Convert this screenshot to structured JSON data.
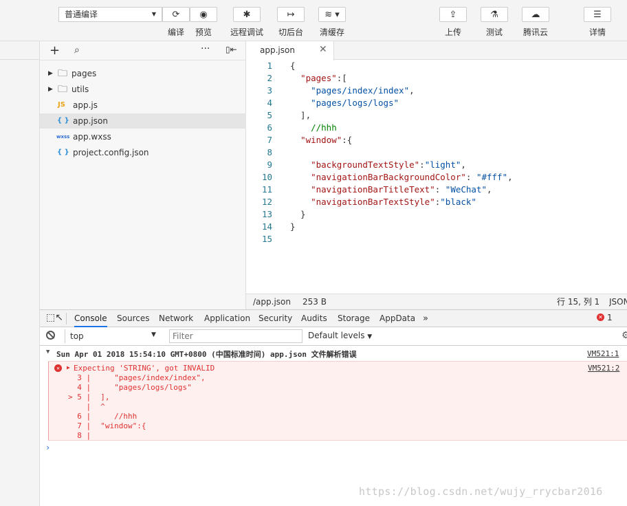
{
  "toolbar": {
    "mode_select": "普通编译",
    "compile": "编译",
    "preview": "预览",
    "remote_debug": "远程调试",
    "background": "切后台",
    "clear_cache": "清缓存",
    "upload": "上传",
    "test": "测试",
    "tencent_cloud": "腾讯云",
    "details": "详情"
  },
  "tree": {
    "items": [
      {
        "name": "pages",
        "type": "folder"
      },
      {
        "name": "utils",
        "type": "folder"
      },
      {
        "name": "app.js",
        "type": "js",
        "icon": "JS"
      },
      {
        "name": "app.json",
        "type": "json",
        "icon": "{ }"
      },
      {
        "name": "app.wxss",
        "type": "wxss",
        "icon": "wxss"
      },
      {
        "name": "project.config.json",
        "type": "json",
        "icon": "{ }"
      }
    ]
  },
  "editor": {
    "tab": "app.json",
    "line_numbers": [
      "1",
      "2",
      "3",
      "4",
      "5",
      "6",
      "7",
      "8",
      "9",
      "10",
      "11",
      "12",
      "13",
      "14",
      "15"
    ],
    "status_path": "/app.json",
    "status_size": "253 B",
    "status_pos": "行 15, 列 1",
    "status_lang": "JSON"
  },
  "devtools": {
    "tabs": [
      "Console",
      "Sources",
      "Network",
      "Application",
      "Security",
      "Audits",
      "Storage",
      "AppData"
    ],
    "error_count": "1",
    "context": "top",
    "filter_placeholder": "Filter",
    "levels": "Default levels",
    "group_header": "Sun Apr 01 2018 15:54:10 GMT+0800 (中国标准时间)  app.json 文件解析错误",
    "group_link": "VM521:1",
    "error_msg": "Expecting 'STRING', got INVALID",
    "error_link": "VM521:2",
    "error_lines": [
      {
        "gutter": "  3 |",
        "text": "     \"pages/index/index\","
      },
      {
        "gutter": "  4 |",
        "text": "     \"pages/logs/logs\""
      },
      {
        "gutter": "> 5 |",
        "text": "  ],"
      },
      {
        "gutter": "    |",
        "text": "  ^"
      },
      {
        "gutter": "  6 |",
        "text": "     //hhh"
      },
      {
        "gutter": "  7 |",
        "text": "  \"window\":{"
      },
      {
        "gutter": "  8 |",
        "text": ""
      }
    ]
  },
  "watermark": "https://blog.csdn.net/wujy_rrycbar2016",
  "colors": {
    "accent": "#1a73e8",
    "error": "#e03030",
    "json_key": "#a31515",
    "json_string": "#0451a5",
    "comment": "#008000"
  }
}
